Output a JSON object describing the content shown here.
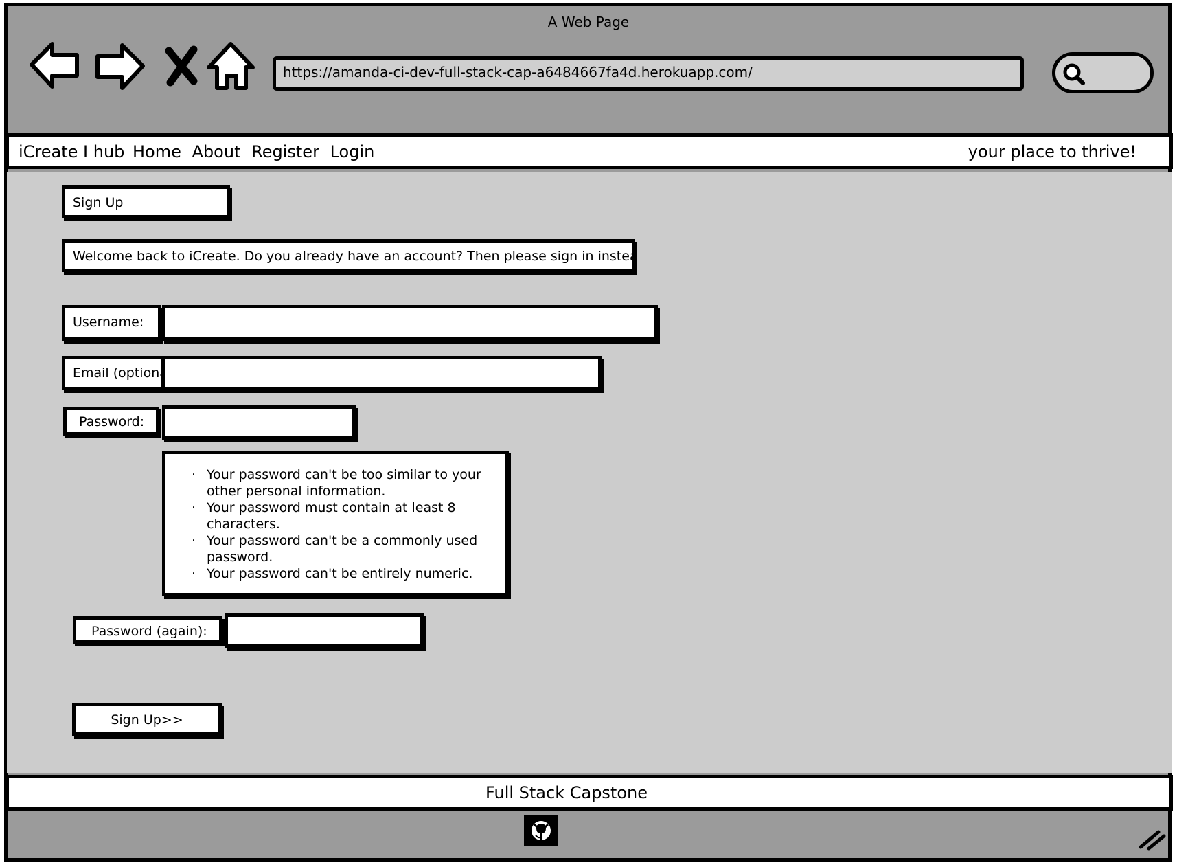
{
  "window": {
    "title": "A Web Page"
  },
  "browser": {
    "url": "https://amanda-ci-dev-full-stack-cap-a6484667fa4d.herokuapp.com/",
    "back_icon": "back-arrow-icon",
    "forward_icon": "forward-arrow-icon",
    "stop_icon": "stop-x-icon",
    "home_icon": "home-icon",
    "search_icon": "search-icon"
  },
  "navbar": {
    "brand": "iCreate I hub",
    "links": [
      "Home",
      "About",
      "Register",
      "Login"
    ],
    "tagline": "your place to thrive!"
  },
  "form": {
    "heading": "Sign Up",
    "welcome": "Welcome back to iCreate. Do you already have an account? Then please sign in instead.",
    "username_label": "Username:",
    "email_label": "Email (optional):",
    "password_label": "Password:",
    "password_rules": [
      "Your password can't be too similar to your other personal information.",
      "Your password must contain at least 8 characters.",
      "Your password can't be a commonly used password.",
      "Your password can't be entirely numeric."
    ],
    "password_again_label": "Password (again):",
    "submit_label": "Sign Up>>"
  },
  "footer": {
    "text": "Full Stack Capstone",
    "github_icon": "github-icon"
  },
  "colors": {
    "chrome": "#9b9b9b",
    "content": "#cccccc",
    "ink": "#000000",
    "paper": "#ffffff"
  }
}
